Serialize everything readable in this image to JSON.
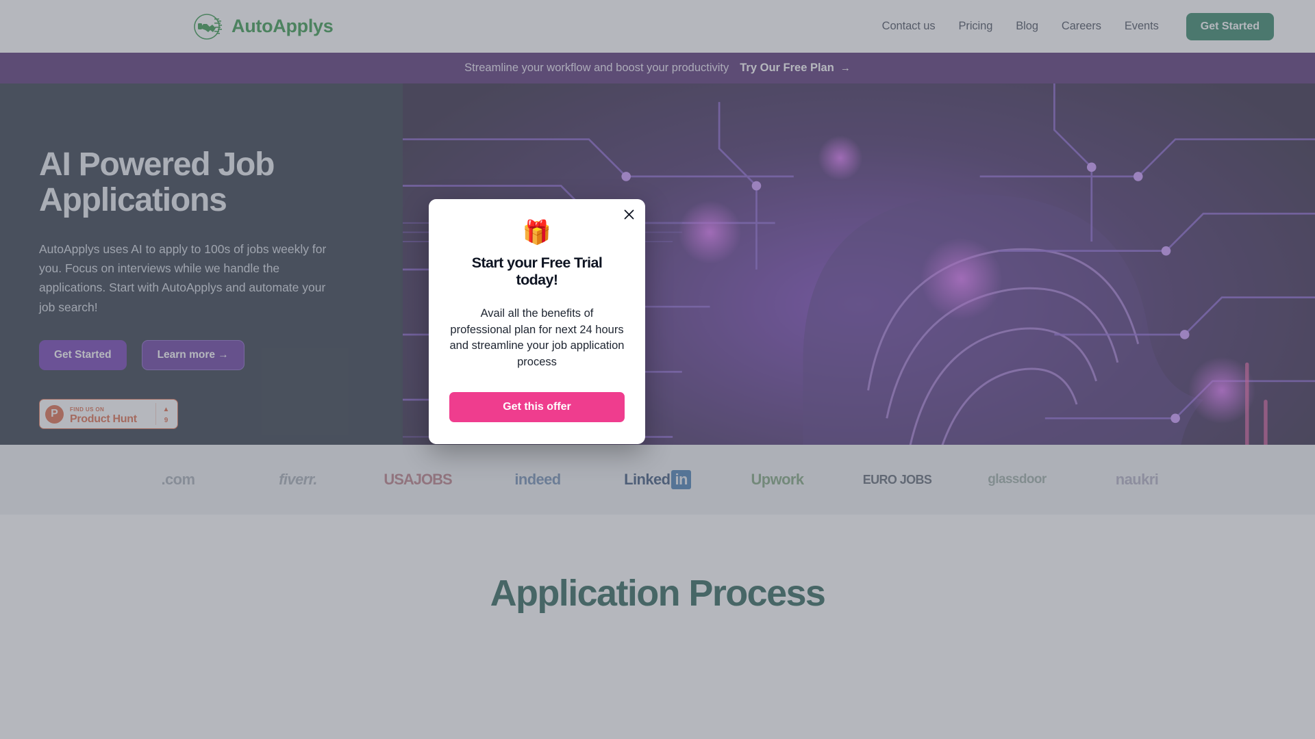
{
  "header": {
    "logo_text": "AutoApplys",
    "logo_icon": "handshake-circuit-logo",
    "nav": [
      {
        "label": "Contact us"
      },
      {
        "label": "Pricing"
      },
      {
        "label": "Blog"
      },
      {
        "label": "Careers"
      },
      {
        "label": "Events"
      }
    ],
    "cta_label": "Get Started",
    "cta_color": "#157350"
  },
  "banner": {
    "message": "Streamline your workflow and boost your productivity",
    "cta_label": "Try Our Free Plan",
    "cta_arrow": "→",
    "background": "#3c1361"
  },
  "hero": {
    "heading": "AI Powered Job Applications",
    "paragraph": "AutoApplys uses AI to apply to 100s of jobs weekly for you. Focus on interviews while we handle the applications. Start with AutoApplys and automate your job search!",
    "primary_button": "Get Started",
    "secondary_button": "Learn more →",
    "background": "#111c2b",
    "product_hunt": {
      "kicker": "FIND US ON",
      "name": "Product Hunt",
      "vote_arrow": "▲",
      "vote_count": "9",
      "brand_color": "#da552f"
    },
    "image_alt": "ai-circuit-brain-illustration"
  },
  "logos": {
    "items": [
      {
        "label": ".com",
        "color": "#9aa2ab"
      },
      {
        "label": "fiverr.",
        "color": "#9aa2ab"
      },
      {
        "label": "USAJOBS",
        "color": "#b06a74"
      },
      {
        "label": "indeed",
        "color": "#5e7fa8"
      },
      {
        "label": "Linked",
        "suffix": "in",
        "color": "#1d3d66"
      },
      {
        "label": "Upwork",
        "color": "#6d9a6b"
      },
      {
        "label": "EURO JOBS",
        "color": "#46505e"
      },
      {
        "label": "glassdoor",
        "color": "#8fa39a"
      },
      {
        "label": "naukri",
        "color": "#a6a4ba"
      }
    ]
  },
  "process": {
    "title": "Application Process"
  },
  "modal": {
    "emoji": "🎁",
    "emoji_name": "gift-emoji",
    "title": "Start your Free Trial today!",
    "body": "Avail all the benefits of professional plan for next 24 hours and streamline your job application process",
    "cta_label": "Get this offer",
    "cta_color": "#ef3d8e",
    "close_icon": "close-icon"
  }
}
